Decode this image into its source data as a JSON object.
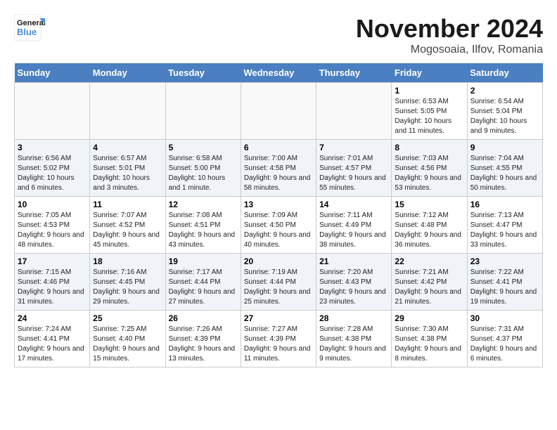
{
  "logo": {
    "line1": "General",
    "line2": "Blue"
  },
  "title": "November 2024",
  "location": "Mogosoaia, Ilfov, Romania",
  "weekdays": [
    "Sunday",
    "Monday",
    "Tuesday",
    "Wednesday",
    "Thursday",
    "Friday",
    "Saturday"
  ],
  "weeks": [
    [
      {
        "day": "",
        "info": ""
      },
      {
        "day": "",
        "info": ""
      },
      {
        "day": "",
        "info": ""
      },
      {
        "day": "",
        "info": ""
      },
      {
        "day": "",
        "info": ""
      },
      {
        "day": "1",
        "info": "Sunrise: 6:53 AM\nSunset: 5:05 PM\nDaylight: 10 hours and 11 minutes."
      },
      {
        "day": "2",
        "info": "Sunrise: 6:54 AM\nSunset: 5:04 PM\nDaylight: 10 hours and 9 minutes."
      }
    ],
    [
      {
        "day": "3",
        "info": "Sunrise: 6:56 AM\nSunset: 5:02 PM\nDaylight: 10 hours and 6 minutes."
      },
      {
        "day": "4",
        "info": "Sunrise: 6:57 AM\nSunset: 5:01 PM\nDaylight: 10 hours and 3 minutes."
      },
      {
        "day": "5",
        "info": "Sunrise: 6:58 AM\nSunset: 5:00 PM\nDaylight: 10 hours and 1 minute."
      },
      {
        "day": "6",
        "info": "Sunrise: 7:00 AM\nSunset: 4:58 PM\nDaylight: 9 hours and 58 minutes."
      },
      {
        "day": "7",
        "info": "Sunrise: 7:01 AM\nSunset: 4:57 PM\nDaylight: 9 hours and 55 minutes."
      },
      {
        "day": "8",
        "info": "Sunrise: 7:03 AM\nSunset: 4:56 PM\nDaylight: 9 hours and 53 minutes."
      },
      {
        "day": "9",
        "info": "Sunrise: 7:04 AM\nSunset: 4:55 PM\nDaylight: 9 hours and 50 minutes."
      }
    ],
    [
      {
        "day": "10",
        "info": "Sunrise: 7:05 AM\nSunset: 4:53 PM\nDaylight: 9 hours and 48 minutes."
      },
      {
        "day": "11",
        "info": "Sunrise: 7:07 AM\nSunset: 4:52 PM\nDaylight: 9 hours and 45 minutes."
      },
      {
        "day": "12",
        "info": "Sunrise: 7:08 AM\nSunset: 4:51 PM\nDaylight: 9 hours and 43 minutes."
      },
      {
        "day": "13",
        "info": "Sunrise: 7:09 AM\nSunset: 4:50 PM\nDaylight: 9 hours and 40 minutes."
      },
      {
        "day": "14",
        "info": "Sunrise: 7:11 AM\nSunset: 4:49 PM\nDaylight: 9 hours and 38 minutes."
      },
      {
        "day": "15",
        "info": "Sunrise: 7:12 AM\nSunset: 4:48 PM\nDaylight: 9 hours and 36 minutes."
      },
      {
        "day": "16",
        "info": "Sunrise: 7:13 AM\nSunset: 4:47 PM\nDaylight: 9 hours and 33 minutes."
      }
    ],
    [
      {
        "day": "17",
        "info": "Sunrise: 7:15 AM\nSunset: 4:46 PM\nDaylight: 9 hours and 31 minutes."
      },
      {
        "day": "18",
        "info": "Sunrise: 7:16 AM\nSunset: 4:45 PM\nDaylight: 9 hours and 29 minutes."
      },
      {
        "day": "19",
        "info": "Sunrise: 7:17 AM\nSunset: 4:44 PM\nDaylight: 9 hours and 27 minutes."
      },
      {
        "day": "20",
        "info": "Sunrise: 7:19 AM\nSunset: 4:44 PM\nDaylight: 9 hours and 25 minutes."
      },
      {
        "day": "21",
        "info": "Sunrise: 7:20 AM\nSunset: 4:43 PM\nDaylight: 9 hours and 23 minutes."
      },
      {
        "day": "22",
        "info": "Sunrise: 7:21 AM\nSunset: 4:42 PM\nDaylight: 9 hours and 21 minutes."
      },
      {
        "day": "23",
        "info": "Sunrise: 7:22 AM\nSunset: 4:41 PM\nDaylight: 9 hours and 19 minutes."
      }
    ],
    [
      {
        "day": "24",
        "info": "Sunrise: 7:24 AM\nSunset: 4:41 PM\nDaylight: 9 hours and 17 minutes."
      },
      {
        "day": "25",
        "info": "Sunrise: 7:25 AM\nSunset: 4:40 PM\nDaylight: 9 hours and 15 minutes."
      },
      {
        "day": "26",
        "info": "Sunrise: 7:26 AM\nSunset: 4:39 PM\nDaylight: 9 hours and 13 minutes."
      },
      {
        "day": "27",
        "info": "Sunrise: 7:27 AM\nSunset: 4:39 PM\nDaylight: 9 hours and 11 minutes."
      },
      {
        "day": "28",
        "info": "Sunrise: 7:28 AM\nSunset: 4:38 PM\nDaylight: 9 hours and 9 minutes."
      },
      {
        "day": "29",
        "info": "Sunrise: 7:30 AM\nSunset: 4:38 PM\nDaylight: 9 hours and 8 minutes."
      },
      {
        "day": "30",
        "info": "Sunrise: 7:31 AM\nSunset: 4:37 PM\nDaylight: 9 hours and 6 minutes."
      }
    ]
  ]
}
